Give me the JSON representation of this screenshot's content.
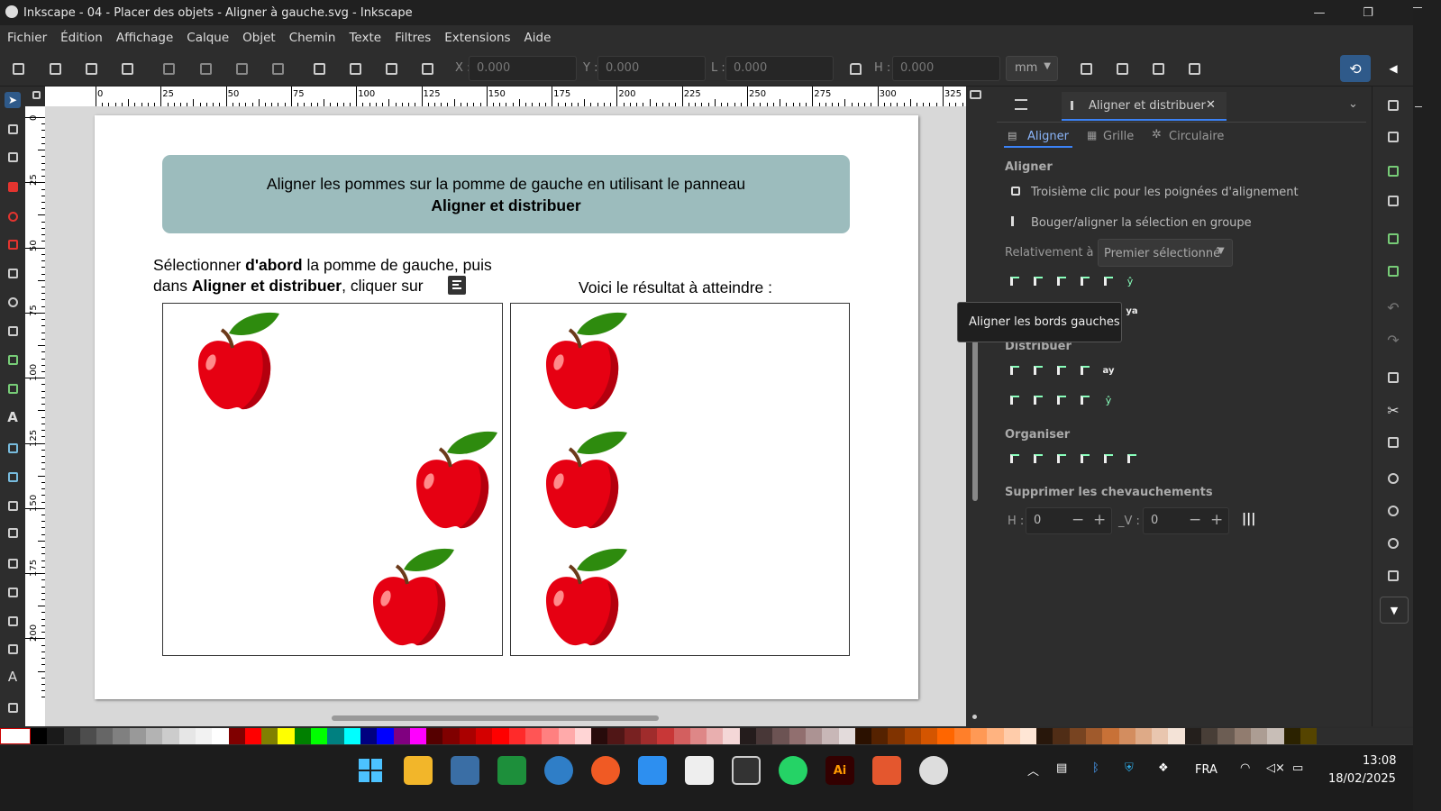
{
  "window": {
    "title": "Inkscape - 04 - Placer des objets - Aligner à gauche.svg - Inkscape",
    "minimize": "—",
    "maximize": "❐",
    "close": "✕"
  },
  "menu": [
    "Fichier",
    "Édition",
    "Affichage",
    "Calque",
    "Objet",
    "Chemin",
    "Texte",
    "Filtres",
    "Extensions",
    "Aide"
  ],
  "toolbar": {
    "x_label": "X :",
    "x_value": "0.000",
    "y_label": "Y :",
    "y_value": "0.000",
    "w_label": "L :",
    "w_value": "0.000",
    "h_label": "H :",
    "h_value": "0.000",
    "unit": "mm"
  },
  "ruler": {
    "h_ticks": [
      "0",
      "25",
      "50",
      "75",
      "100",
      "125",
      "150",
      "175",
      "200",
      "225",
      "250",
      "275",
      "300",
      "325"
    ],
    "v_ticks": [
      "0",
      "25",
      "50",
      "75",
      "100",
      "125",
      "150",
      "175",
      "200"
    ]
  },
  "canvas": {
    "banner_line1": "Aligner les pommes sur la pomme de gauche en utilisant le panneau",
    "banner_line2": "Aligner et distribuer",
    "instr_a": "Sélectionner ",
    "instr_b": "d'abord",
    "instr_c": " la pomme de gauche, puis",
    "instr_d": "dans ",
    "instr_e": "Aligner et distribuer",
    "instr_f": ", cliquer sur",
    "result": "Voici le résultat à atteindre :"
  },
  "panel": {
    "dock_tab": "Aligner et distribuer",
    "tabs": [
      "Aligner",
      "Grille",
      "Circulaire"
    ],
    "align_heading": "Aligner",
    "opt1": "Troisième clic pour les poignées d'alignement",
    "opt2": "Bouger/aligner la sélection en groupe",
    "relative_label": "Relativement à :",
    "relative_value": "Premier sélectionné",
    "distribute_heading": "Distribuer",
    "arrange_heading": "Organiser",
    "overlap_heading": "Supprimer les chevauchements",
    "h_label": "H :",
    "h_value": "0",
    "v_label": "_V :",
    "v_value": "0",
    "tooltip": "Aligner les bords gauches"
  },
  "taskbar": {
    "lang": "FRA",
    "time": "13:08",
    "date": "18/02/2025",
    "ai_label": "Ai"
  },
  "colors": {
    "accent": "#2f5a8a",
    "banner": "#9cbcbd",
    "apple": "#e60012",
    "leaf": "#2e8b0e"
  }
}
